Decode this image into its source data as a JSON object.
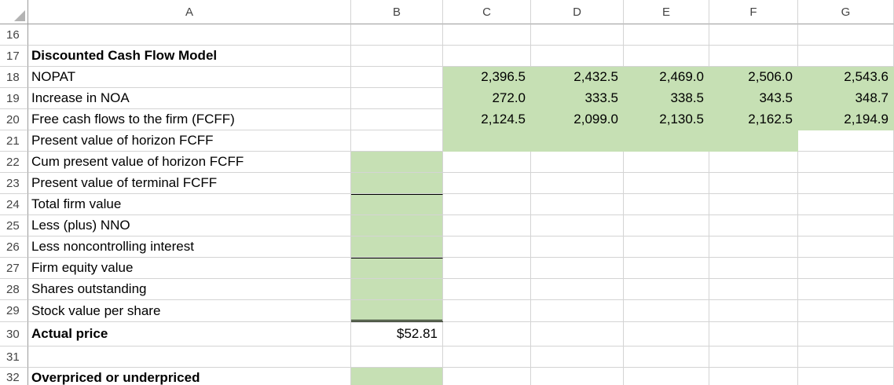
{
  "columns": [
    "A",
    "B",
    "C",
    "D",
    "E",
    "F",
    "G"
  ],
  "rows": [
    {
      "num": "16",
      "label": "",
      "bold": false
    },
    {
      "num": "17",
      "label": "Discounted Cash Flow Model",
      "bold": true
    },
    {
      "num": "18",
      "label": "NOPAT",
      "bold": false,
      "values": [
        "2,396.5",
        "2,432.5",
        "2,469.0",
        "2,506.0",
        "2,543.6"
      ]
    },
    {
      "num": "19",
      "label": "Increase in NOA",
      "bold": false,
      "values": [
        "272.0",
        "333.5",
        "338.5",
        "343.5",
        "348.7"
      ]
    },
    {
      "num": "20",
      "label": "Free cash flows to the firm (FCFF)",
      "bold": false,
      "values": [
        "2,124.5",
        "2,099.0",
        "2,130.5",
        "2,162.5",
        "2,194.9"
      ]
    },
    {
      "num": "21",
      "label": "Present value of horizon FCFF",
      "bold": false
    },
    {
      "num": "22",
      "label": "Cum present value of horizon FCFF",
      "bold": false
    },
    {
      "num": "23",
      "label": "Present value of terminal FCFF",
      "bold": false
    },
    {
      "num": "24",
      "label": "Total firm value",
      "bold": false
    },
    {
      "num": "25",
      "label": "Less (plus) NNO",
      "bold": false
    },
    {
      "num": "26",
      "label": "Less noncontrolling interest",
      "bold": false
    },
    {
      "num": "27",
      "label": "Firm equity value",
      "bold": false
    },
    {
      "num": "28",
      "label": "Shares outstanding",
      "bold": false
    },
    {
      "num": "29",
      "label": "Stock value per share",
      "bold": false
    },
    {
      "num": "30",
      "label": "Actual price",
      "bold": true,
      "b_value": "$52.81"
    },
    {
      "num": "31",
      "label": "",
      "bold": false
    },
    {
      "num": "32",
      "label": "Overpriced or underpriced",
      "bold": true
    }
  ],
  "colors": {
    "fill_green": "#c6e0b4",
    "gridline": "#d4d4d4",
    "header_text": "#444444"
  }
}
